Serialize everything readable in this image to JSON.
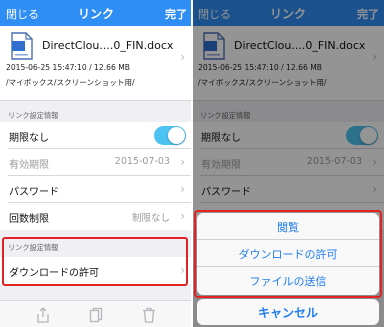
{
  "colors": {
    "accent": "#2f8ef3",
    "link": "#1e7cf0",
    "toggle_on": "#4cc3f2",
    "highlight": "#e02323"
  },
  "nav": {
    "close_label": "閉じる",
    "title": "リンク",
    "done_label": "完了"
  },
  "file": {
    "icon": "document-icon",
    "name": "DirectClou....0_FIN.docx",
    "meta": "2015-06-25 15:47:10 / 12.66 MB",
    "path": "/マイボックス/スクリーンショット用/"
  },
  "link_settings": {
    "header": "リンク設定情報",
    "rows": [
      {
        "label": "期限なし",
        "toggle_on": true
      },
      {
        "label": "有効期限",
        "value": "2015-07-03"
      },
      {
        "label": "パスワード"
      },
      {
        "label": "回数制限",
        "value": "制限なし"
      }
    ]
  },
  "download_section": {
    "header": "リンク設定情報",
    "row_label": "ダウンロードの許可"
  },
  "toolbar": {
    "icons": [
      "upload-icon",
      "copy-icon",
      "trash-icon"
    ]
  },
  "action_sheet": {
    "items": [
      "閲覧",
      "ダウンロードの許可",
      "ファイルの送信"
    ],
    "cancel_label": "キャンセル"
  }
}
